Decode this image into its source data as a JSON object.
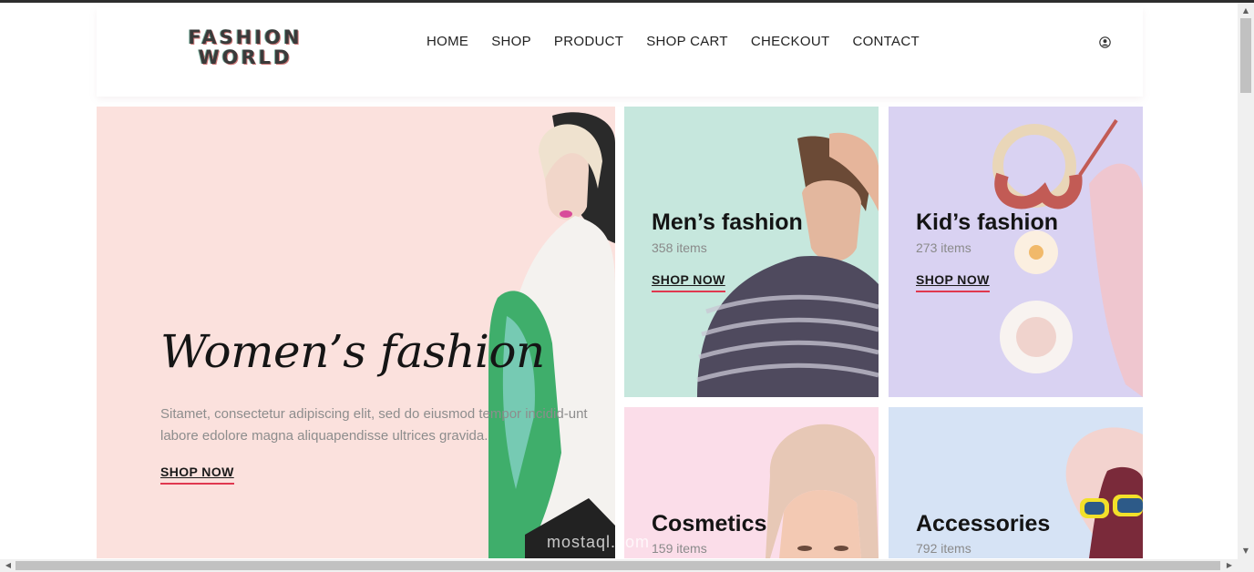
{
  "header": {
    "logo_line1": "FASHION",
    "logo_line2": "WORLD",
    "nav": [
      "HOME",
      "SHOP",
      "PRODUCT",
      "SHOP CART",
      "CHECKOUT",
      "CONTACT"
    ],
    "user_icon": "user-circle-icon"
  },
  "hero": {
    "title": "Women’s fashion",
    "description": "Sitamet, consectetur adipiscing elit, sed do eiusmod tempor incidid-unt labore edolore magna aliquapendisse ultrices gravida.",
    "cta": "SHOP NOW"
  },
  "categories": {
    "men": {
      "title": "Men’s fashion",
      "count": "358 items",
      "cta": "SHOP NOW"
    },
    "kid": {
      "title": "Kid’s fashion",
      "count": "273 items",
      "cta": "SHOP NOW"
    },
    "cosmetics": {
      "title": "Cosmetics",
      "count": "159 items"
    },
    "accessories": {
      "title": "Accessories",
      "count": "792 items"
    }
  },
  "watermark": "mostaql.com",
  "colors": {
    "hero_bg": "#fbe1dd",
    "men_bg": "#c6e7dd",
    "kid_bg": "#d9d2f2",
    "cosmetics_bg": "#fbdde9",
    "accessories_bg": "#d6e3f5",
    "accent": "#e0384f"
  }
}
